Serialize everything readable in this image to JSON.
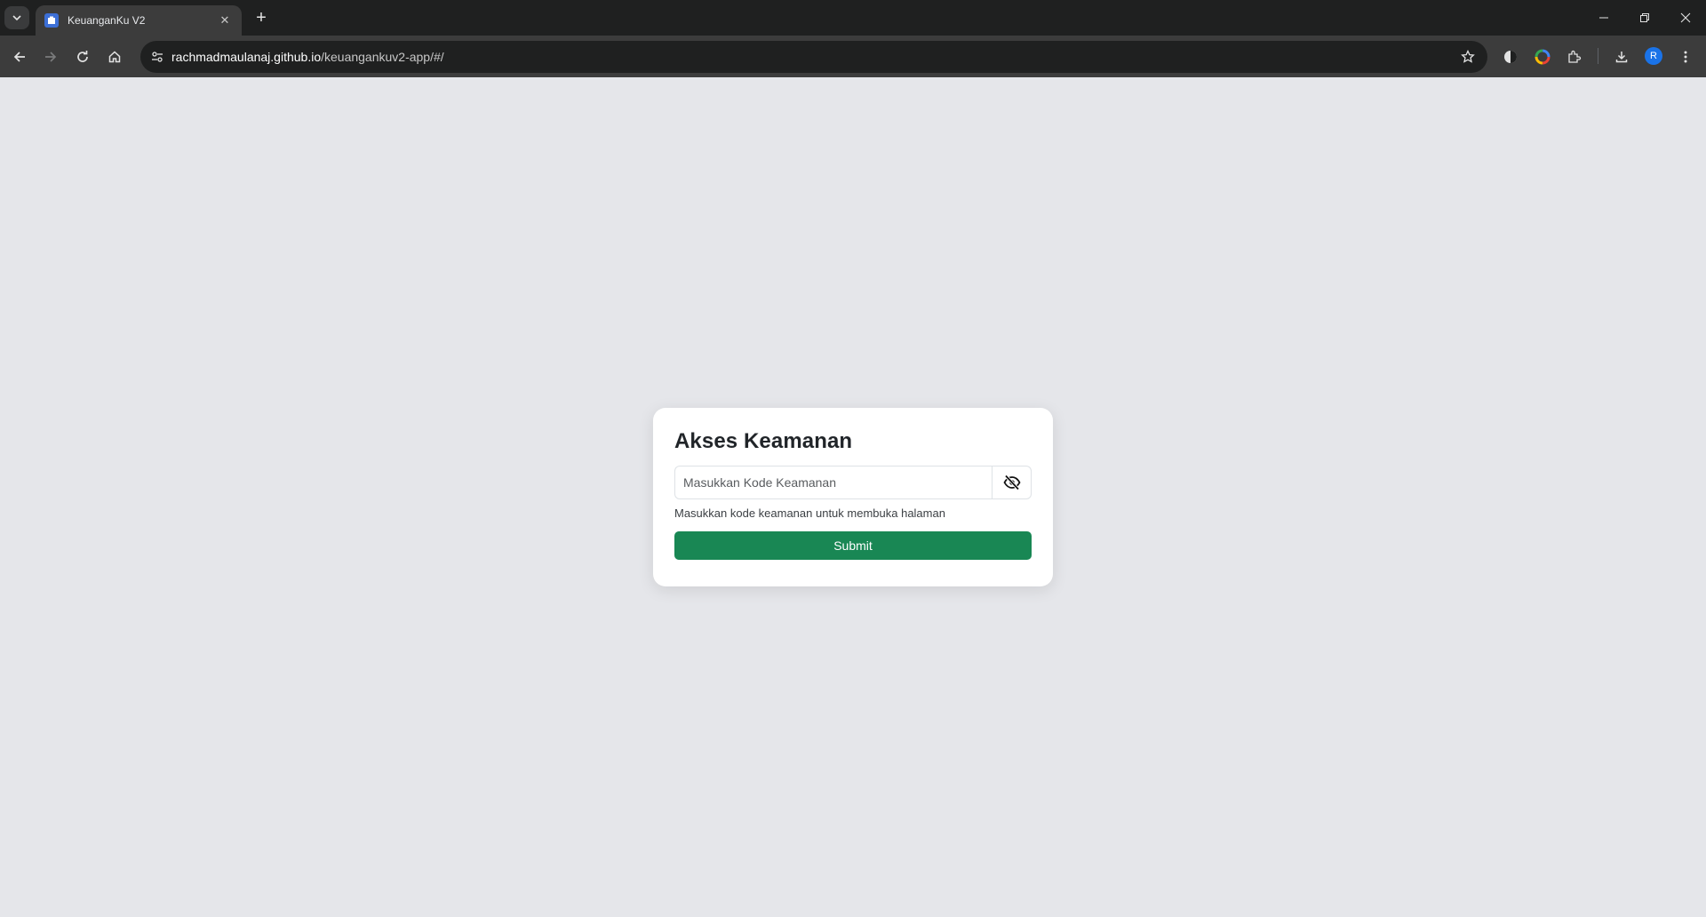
{
  "browser": {
    "tab": {
      "title": "KeuanganKu V2"
    },
    "new_tab_symbol": "+",
    "close_tab_symbol": "✕",
    "url": {
      "host": "rachmadmaulanaj.github.io",
      "path": "/keuangankuv2-app/#/"
    },
    "profile_initial": "R",
    "icons": [
      "tab-search-icon",
      "back-icon",
      "forward-icon",
      "reload-icon",
      "home-icon",
      "site-info-icon",
      "bookmark-star-icon",
      "extension-icon",
      "color-extension-icon",
      "puzzle-icon",
      "download-icon",
      "menu-icon",
      "minimize-icon",
      "restore-icon",
      "close-icon"
    ]
  },
  "page": {
    "title": "Akses Keamanan",
    "input": {
      "placeholder": "Masukkan Kode Keamanan",
      "value": ""
    },
    "help_text": "Masukkan kode keamanan untuk membuka halaman",
    "submit_label": "Submit",
    "toggle_icon": "eye-slash-icon"
  },
  "colors": {
    "primary_button": "#198754",
    "page_background": "#e5e6ea",
    "chrome_dark": "#1f2020",
    "toolbar": "#3c3c3c"
  }
}
